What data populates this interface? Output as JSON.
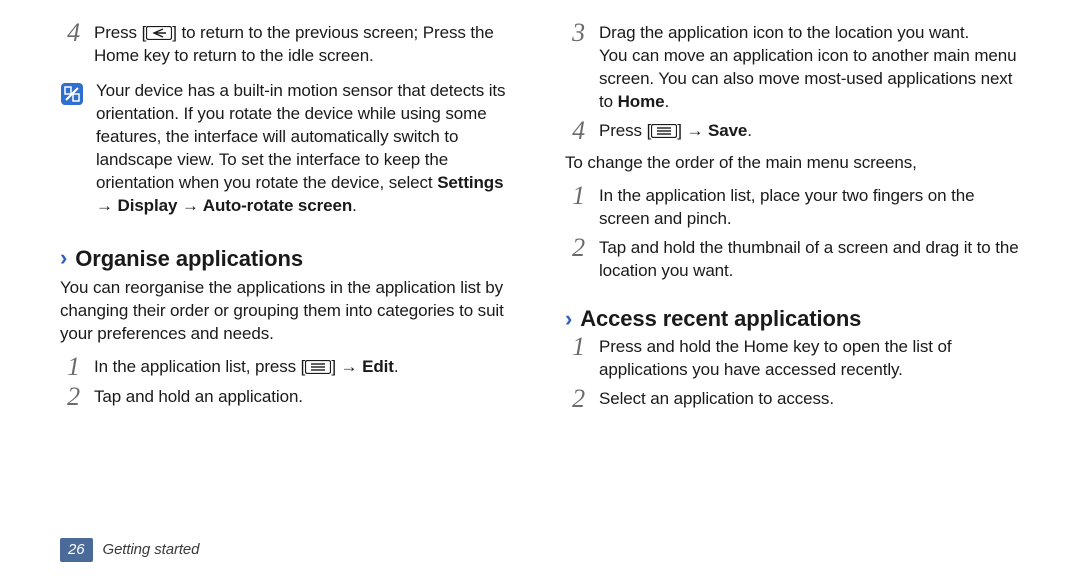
{
  "left": {
    "step4_prefix": "Press [",
    "step4_suffix": "] to return to the previous screen; Press the Home key to return to the idle screen.",
    "note_prefix": "Your device has a built-in motion sensor that detects its orientation. If you rotate the device while using some features, the interface will automatically switch to landscape view. To set the interface to keep the orientation when you rotate the device, select ",
    "note_bold": "Settings → Display → Auto-rotate screen",
    "note_suffix": ".",
    "section_title": "Organise applications",
    "section_para": "You can reorganise the applications in the application list by changing their order or grouping them into categories to suit your preferences and needs.",
    "step1_prefix": "In the application list, press [",
    "step1_mid": "] → ",
    "step1_bold": "Edit",
    "step1_suffix": ".",
    "step2": "Tap and hold an application."
  },
  "right": {
    "step3_line1": "Drag the application icon to the location you want.",
    "step3_line2_prefix": "You can move an application icon to another main menu screen. You can also move most-used applications next to ",
    "step3_line2_bold": "Home",
    "step3_line2_suffix": ".",
    "step4_prefix": "Press [",
    "step4_mid": "] → ",
    "step4_bold": "Save",
    "step4_suffix": ".",
    "change_order_intro": "To change the order of the main menu screens,",
    "co_step1": "In the application list, place your two fingers on the screen and pinch.",
    "co_step2": "Tap and hold the thumbnail of a screen and drag it to the location you want.",
    "section_title": "Access recent applications",
    "ar_step1": "Press and hold the Home key to open the list of applications you have accessed recently.",
    "ar_step2": "Select an application to access."
  },
  "footer": {
    "page_number": "26",
    "section": "Getting started"
  }
}
